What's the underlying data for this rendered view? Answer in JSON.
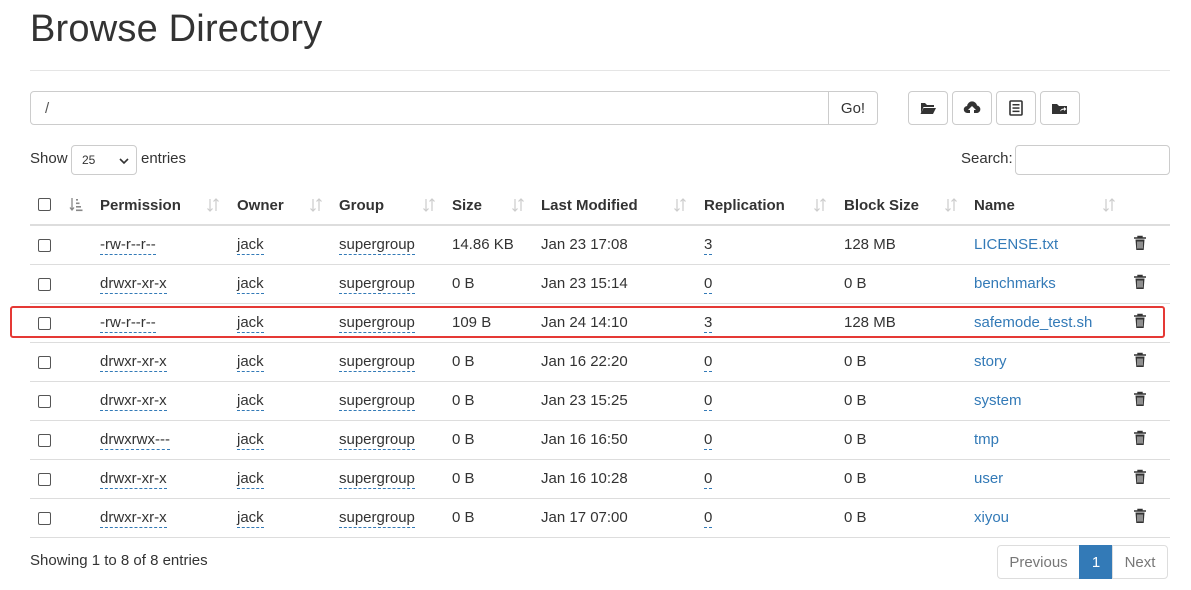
{
  "page": {
    "title": "Browse Directory"
  },
  "path_bar": {
    "value": "/",
    "go_label": "Go!"
  },
  "toolbar": {
    "icons": [
      "folder-open-icon",
      "cloud-upload-icon",
      "list-alt-icon",
      "folder-share-icon"
    ]
  },
  "length_menu": {
    "show_label": "Show",
    "selected": "25",
    "entries_label": "entries"
  },
  "search": {
    "label": "Search:",
    "value": ""
  },
  "table": {
    "columns": [
      "Permission",
      "Owner",
      "Group",
      "Size",
      "Last Modified",
      "Replication",
      "Block Size",
      "Name"
    ],
    "rows": [
      {
        "permission": "-rw-r--r--",
        "owner": "jack",
        "group": "supergroup",
        "size": "14.86 KB",
        "modified": "Jan 23 17:08",
        "replication": "3",
        "block_size": "128 MB",
        "name": "LICENSE.txt"
      },
      {
        "permission": "drwxr-xr-x",
        "owner": "jack",
        "group": "supergroup",
        "size": "0 B",
        "modified": "Jan 23 15:14",
        "replication": "0",
        "block_size": "0 B",
        "name": "benchmarks"
      },
      {
        "permission": "-rw-r--r--",
        "owner": "jack",
        "group": "supergroup",
        "size": "109 B",
        "modified": "Jan 24 14:10",
        "replication": "3",
        "block_size": "128 MB",
        "name": "safemode_test.sh"
      },
      {
        "permission": "drwxr-xr-x",
        "owner": "jack",
        "group": "supergroup",
        "size": "0 B",
        "modified": "Jan 16 22:20",
        "replication": "0",
        "block_size": "0 B",
        "name": "story"
      },
      {
        "permission": "drwxr-xr-x",
        "owner": "jack",
        "group": "supergroup",
        "size": "0 B",
        "modified": "Jan 23 15:25",
        "replication": "0",
        "block_size": "0 B",
        "name": "system"
      },
      {
        "permission": "drwxrwx---",
        "owner": "jack",
        "group": "supergroup",
        "size": "0 B",
        "modified": "Jan 16 16:50",
        "replication": "0",
        "block_size": "0 B",
        "name": "tmp"
      },
      {
        "permission": "drwxr-xr-x",
        "owner": "jack",
        "group": "supergroup",
        "size": "0 B",
        "modified": "Jan 16 10:28",
        "replication": "0",
        "block_size": "0 B",
        "name": "user"
      },
      {
        "permission": "drwxr-xr-x",
        "owner": "jack",
        "group": "supergroup",
        "size": "0 B",
        "modified": "Jan 17 07:00",
        "replication": "0",
        "block_size": "0 B",
        "name": "xiyou"
      }
    ],
    "highlighted_row": 2
  },
  "footer": {
    "info": "Showing 1 to 8 of 8 entries",
    "pagination": {
      "previous": "Previous",
      "current": "1",
      "next": "Next"
    }
  },
  "colors": {
    "link": "#337ab7",
    "highlight": "#e53935",
    "active_page": "#337ab7"
  }
}
